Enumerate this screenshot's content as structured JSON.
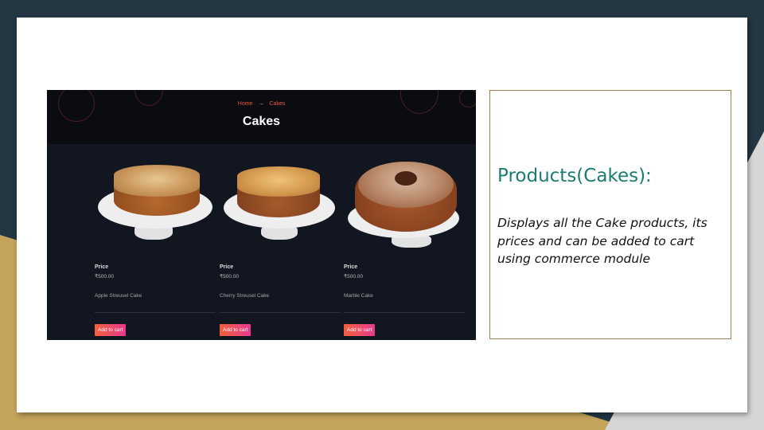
{
  "screenshot": {
    "breadcrumb": {
      "home": "Home",
      "separator": "→",
      "current": "Cakes"
    },
    "hero_title": "Cakes",
    "products": [
      {
        "price_label": "Price",
        "price": "₹500.00",
        "name": "Apple Streusel Cake",
        "button": "Add to cart"
      },
      {
        "price_label": "Price",
        "price": "₹500.00",
        "name": "Cherry Streusel Cake",
        "button": "Add to cart"
      },
      {
        "price_label": "Price",
        "price": "₹500.00",
        "name": "Marble Cake",
        "button": "Add to cart"
      }
    ]
  },
  "caption": {
    "title": "Products(Cakes):",
    "description": "Displays all the Cake products, its prices and can be added to cart using commerce module"
  },
  "colors": {
    "accent_teal": "#1d7c72",
    "breadcrumb_orange": "#e8573f",
    "button_gradient_start": "#f2603c",
    "button_gradient_end": "#e83a8e"
  }
}
